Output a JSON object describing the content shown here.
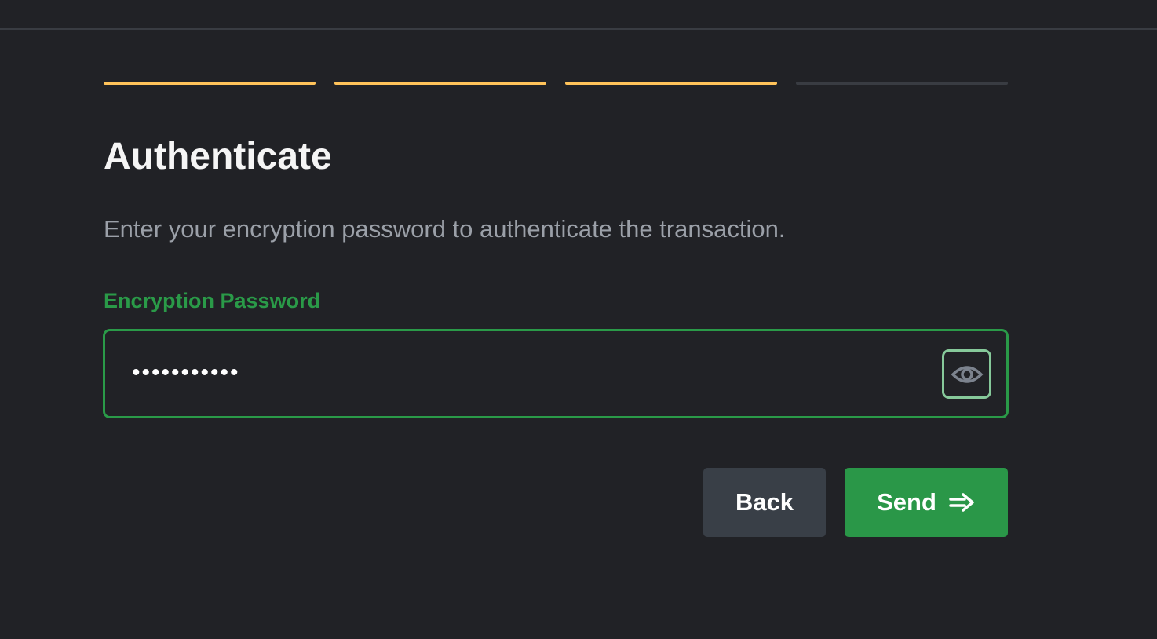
{
  "progress": {
    "total_steps": 4,
    "completed_steps": 3,
    "active_color": "#ffc35a",
    "inactive_color": "#393c42"
  },
  "title": "Authenticate",
  "subtitle": "Enter your encryption password to authenticate the transaction.",
  "field": {
    "label": "Encryption Password",
    "masked_value": "•••••••••••",
    "icon": "eye-icon"
  },
  "buttons": {
    "back": "Back",
    "send": "Send",
    "send_icon": "arrow-right-icon"
  }
}
